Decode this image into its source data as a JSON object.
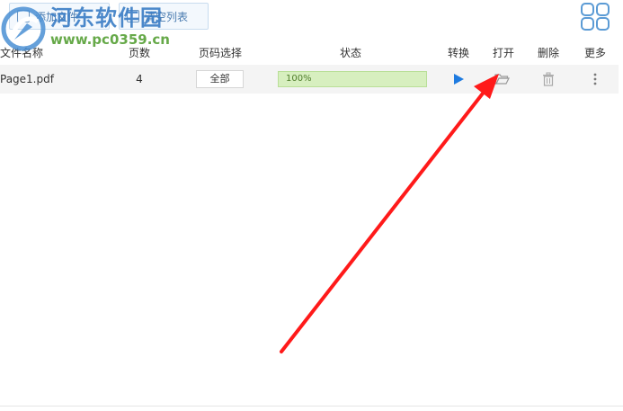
{
  "toolbar": {
    "add_files_label": "添加文件",
    "clear_list_label": "清空列表"
  },
  "watermark": {
    "title": "河东软件园",
    "url": "www.pc0359.cn"
  },
  "table": {
    "headers": {
      "name": "文件名称",
      "pages": "页数",
      "range": "页码选择",
      "status": "状态",
      "convert": "转换",
      "open": "打开",
      "delete": "删除",
      "more": "更多"
    },
    "rows": [
      {
        "name": "Page1.pdf",
        "pages": "4",
        "range": "全部",
        "status_text": "100%",
        "progress": 1.0
      }
    ]
  },
  "colors": {
    "progress_border": "#b9df98",
    "progress_fill": "#d7efbf",
    "convert_play": "#1e7be0",
    "annotation_arrow": "#ff1a1a"
  },
  "icons": {
    "convert": "play-icon",
    "open": "folder-open-icon",
    "delete": "trash-icon",
    "more": "more-vertical-icon",
    "view": "grid-view-icon"
  }
}
